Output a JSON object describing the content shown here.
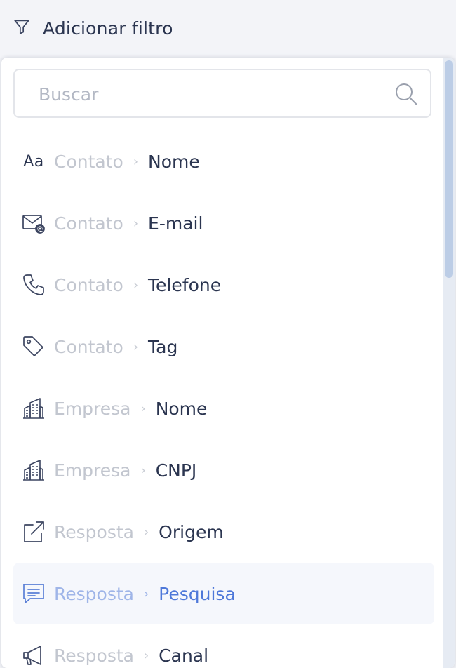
{
  "header": {
    "add_filter_label": "Adicionar filtro",
    "icon": "filter-icon"
  },
  "dropdown": {
    "search": {
      "placeholder": "Buscar",
      "value": "",
      "icon": "search-icon"
    },
    "items": [
      {
        "icon": "text-icon",
        "icon_text": "Aa",
        "category": "Contato",
        "name": "Nome",
        "active": false
      },
      {
        "icon": "email-icon",
        "category": "Contato",
        "name": "E-mail",
        "active": false
      },
      {
        "icon": "phone-icon",
        "category": "Contato",
        "name": "Telefone",
        "active": false
      },
      {
        "icon": "tag-icon",
        "category": "Contato",
        "name": "Tag",
        "active": false
      },
      {
        "icon": "building-icon",
        "category": "Empresa",
        "name": "Nome",
        "active": false
      },
      {
        "icon": "building-icon",
        "category": "Empresa",
        "name": "CNPJ",
        "active": false
      },
      {
        "icon": "external-link-icon",
        "category": "Resposta",
        "name": "Origem",
        "active": false
      },
      {
        "icon": "message-icon",
        "category": "Resposta",
        "name": "Pesquisa",
        "active": true
      },
      {
        "icon": "megaphone-icon",
        "category": "Resposta",
        "name": "Canal",
        "active": false
      }
    ],
    "separator": "›"
  },
  "colors": {
    "accent": "#4e78d9",
    "text": "#2b3550",
    "muted": "#c2c6cf"
  }
}
